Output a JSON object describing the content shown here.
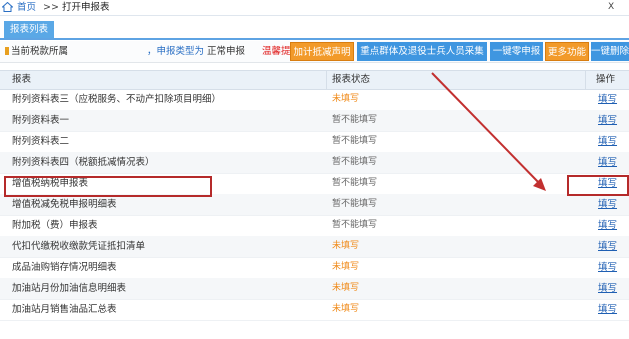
{
  "breadcrumb": {
    "home": "首页",
    "separator": ">>",
    "current": "打开申报表",
    "close": "X"
  },
  "tabs": [
    {
      "label": "报表列表"
    }
  ],
  "infobar": {
    "prefix": "当前税款所属",
    "mid": "，申报类型为",
    "type": "正常申报",
    "tip": "温馨提"
  },
  "toolbar": [
    {
      "label": "加计抵减声明",
      "style": "orange"
    },
    {
      "label": "重点群体及退役士兵人员采集",
      "style": "blue"
    },
    {
      "label": "一键零申报",
      "style": "blue"
    },
    {
      "label": "更多功能",
      "style": "orange"
    },
    {
      "label": "一键删除",
      "style": "blue"
    }
  ],
  "table": {
    "headers": {
      "name": "报表",
      "status": "报表状态",
      "action": "操作"
    },
    "rows": [
      {
        "name": "附列资料表三（应税服务、不动产扣除项目明细）",
        "status": "未填写",
        "status_type": "todo",
        "action": "填写"
      },
      {
        "name": "附列资料表一",
        "status": "暂不能填写",
        "status_type": "na",
        "action": "填写"
      },
      {
        "name": "附列资料表二",
        "status": "暂不能填写",
        "status_type": "na",
        "action": "填写"
      },
      {
        "name": "附列资料表四（税额抵减情况表）",
        "status": "暂不能填写",
        "status_type": "na",
        "action": "填写"
      },
      {
        "name": "增值税纳税申报表",
        "status": "暂不能填写",
        "status_type": "na",
        "action": "填写"
      },
      {
        "name": "增值税减免税申报明细表",
        "status": "暂不能填写",
        "status_type": "na",
        "action": "填写"
      },
      {
        "name": "附加税（费）申报表",
        "status": "暂不能填写",
        "status_type": "na",
        "action": "填写"
      },
      {
        "name": "代扣代缴税收缴款凭证抵扣清单",
        "status": "未填写",
        "status_type": "todo",
        "action": "填写"
      },
      {
        "name": "成品油购销存情况明细表",
        "status": "未填写",
        "status_type": "todo",
        "action": "填写"
      },
      {
        "name": "加油站月份加油信息明细表",
        "status": "未填写",
        "status_type": "todo",
        "action": "填写"
      },
      {
        "name": "加油站月销售油品汇总表",
        "status": "未填写",
        "status_type": "todo",
        "action": "填写"
      }
    ]
  },
  "colors": {
    "accent": "#3f96e0",
    "highlight": "#b52a2a",
    "todo": "#f08a18",
    "link": "#1f5fb3"
  }
}
